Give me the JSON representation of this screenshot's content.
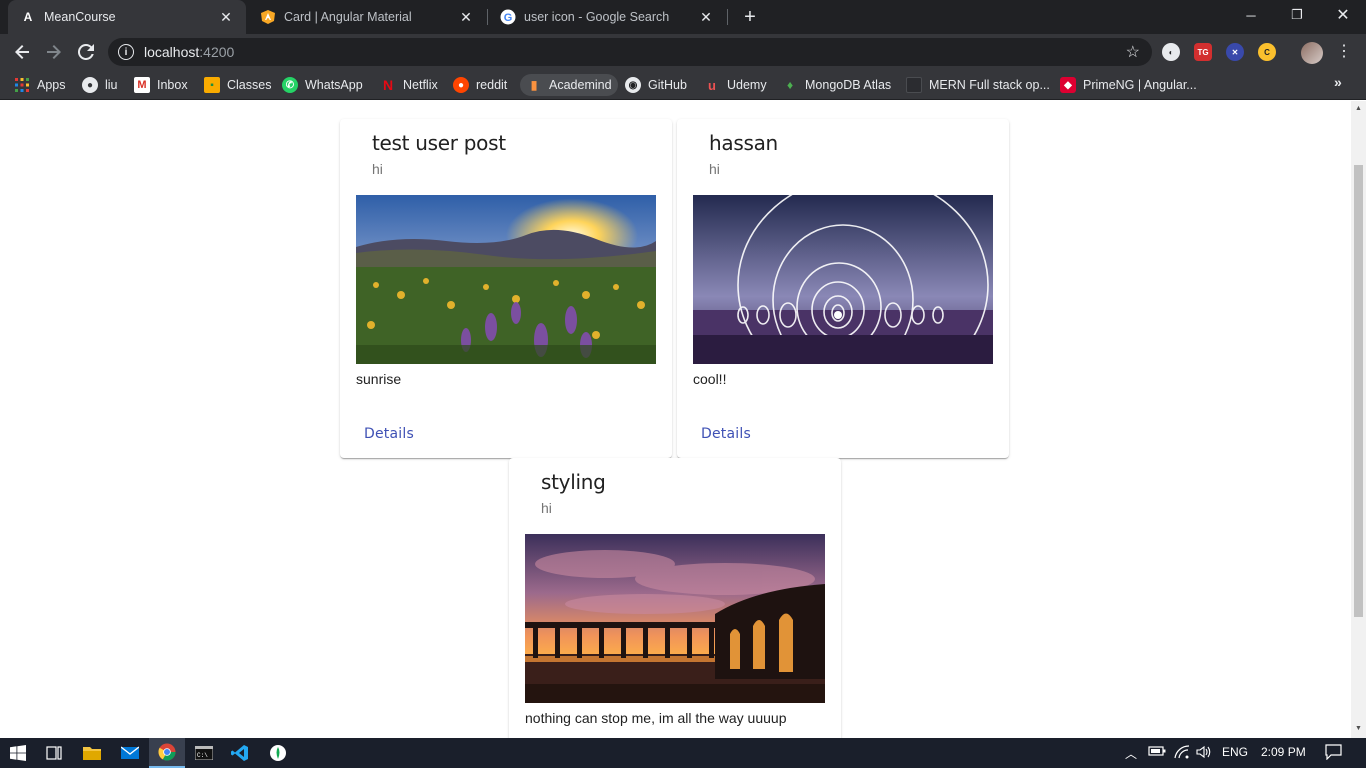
{
  "browser": {
    "tabs": [
      {
        "title": "MeanCourse",
        "icon": "angular-icon",
        "active": true
      },
      {
        "title": "Card | Angular Material",
        "icon": "angular-material-icon",
        "active": false
      },
      {
        "title": "user icon - Google Search",
        "icon": "google-icon",
        "active": false
      }
    ],
    "address": {
      "host": "localhost",
      "port": ":4200"
    },
    "bookmarks": [
      {
        "label": "Apps",
        "icon": "apps-grid-icon"
      },
      {
        "label": "liu",
        "icon": "globe-icon"
      },
      {
        "label": "Inbox",
        "icon": "gmail-icon"
      },
      {
        "label": "Classes",
        "icon": "classroom-icon"
      },
      {
        "label": "WhatsApp",
        "icon": "whatsapp-icon"
      },
      {
        "label": "Netflix",
        "icon": "netflix-icon"
      },
      {
        "label": "reddit",
        "icon": "reddit-icon"
      },
      {
        "label": "Academind",
        "icon": "bookmark-icon"
      },
      {
        "label": "GitHub",
        "icon": "github-icon"
      },
      {
        "label": "Udemy",
        "icon": "udemy-icon"
      },
      {
        "label": "MongoDB Atlas",
        "icon": "mongodb-icon"
      },
      {
        "label": "MERN Full stack op...",
        "icon": "page-icon"
      },
      {
        "label": "PrimeNG | Angular...",
        "icon": "primeng-icon"
      }
    ]
  },
  "posts": [
    {
      "title": "test user post",
      "subtitle": "hi",
      "content": "sunrise",
      "action": "Details",
      "image": "sunrise-flowers-image"
    },
    {
      "title": "hassan",
      "subtitle": "hi",
      "content": "cool!!",
      "action": "Details",
      "image": "light-spiral-image"
    },
    {
      "title": "styling",
      "subtitle": "hi",
      "content": "nothing can stop me, im all the way uuuup",
      "action": "",
      "image": "sunset-colonnade-image"
    }
  ],
  "taskbar": {
    "language": "ENG",
    "time": "2:09 PM"
  },
  "colors": {
    "accent": "#3f51b5",
    "tabstrip": "#202124",
    "toolbar": "#35363a"
  }
}
